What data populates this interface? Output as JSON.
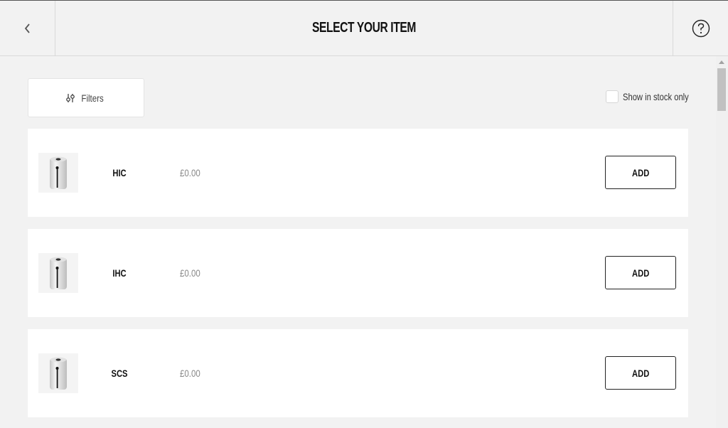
{
  "header": {
    "title": "SELECT YOUR ITEM",
    "back_icon": "chevron-left-icon",
    "help_icon": "question-circle-icon"
  },
  "toolbar": {
    "filters_label": "Filters",
    "filters_icon": "sliders-icon",
    "stock_only_label": "Show in stock only",
    "stock_only_checked": false
  },
  "items": [
    {
      "name": "HIC",
      "price": "£0.00",
      "add_label": "ADD",
      "image": "cylinder-product-image"
    },
    {
      "name": "IHC",
      "price": "£0.00",
      "add_label": "ADD",
      "image": "cylinder-product-image"
    },
    {
      "name": "SCS",
      "price": "£0.00",
      "add_label": "ADD",
      "image": "cylinder-product-image"
    }
  ],
  "colors": {
    "background": "#f2f2f2",
    "card": "#ffffff",
    "text": "#111111",
    "price": "#888888"
  }
}
